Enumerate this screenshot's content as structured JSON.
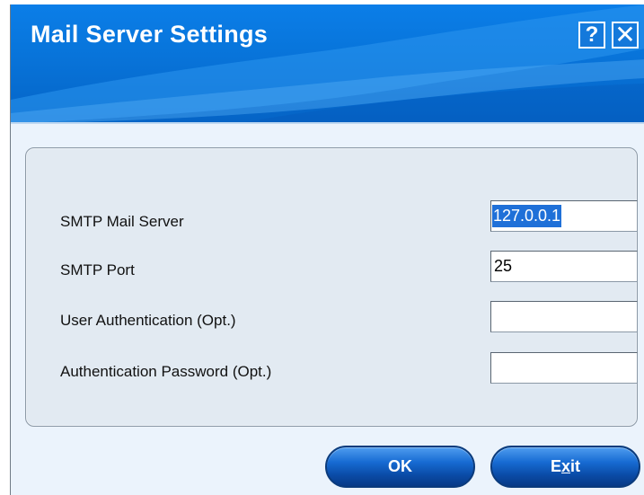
{
  "window": {
    "title": "Mail Server Settings",
    "help_label": "?",
    "close_label": "✕"
  },
  "form": {
    "smtp_mail_server": {
      "label": "SMTP Mail Server",
      "value": "127.0.0.1"
    },
    "smtp_port": {
      "label": "SMTP Port",
      "value": "25"
    },
    "user_authentication": {
      "label": "User Authentication (Opt.)",
      "value": ""
    },
    "authentication_password": {
      "label": "Authentication Password (Opt.)",
      "value": ""
    }
  },
  "buttons": {
    "ok_label": "OK",
    "exit_prefix": "E",
    "exit_mnemonic": "x",
    "exit_suffix": "it"
  },
  "colors": {
    "title_bar": "#0875db",
    "dialog_background": "#ebf3fc",
    "group_background": "#e2eaf2",
    "selection": "#1f70d8",
    "button_blue": "#0a4ba6"
  },
  "icons": {
    "help": "help-icon",
    "close": "close-icon"
  }
}
